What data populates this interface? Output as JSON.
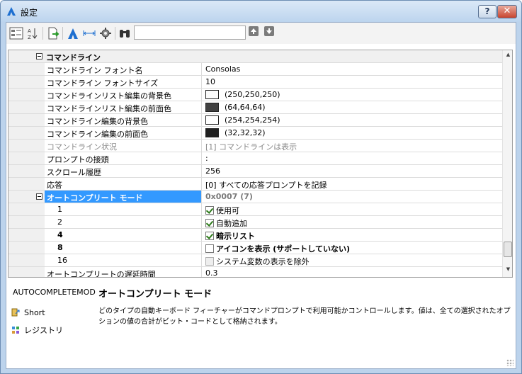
{
  "window": {
    "title": "設定",
    "help_label": "?",
    "close_label": "✕"
  },
  "toolbar": {
    "search_value": "",
    "search_placeholder": ""
  },
  "grid": {
    "category": {
      "label": "コマンドライン"
    },
    "rows": [
      {
        "name": "コマンドライン フォント名",
        "value": "Consolas"
      },
      {
        "name": "コマンドライン フォントサイズ",
        "value": "10"
      },
      {
        "name": "コマンドラインリスト編集の背景色",
        "value": "(250,250,250)",
        "swatch": "#fafafa"
      },
      {
        "name": "コマンドラインリスト編集の前面色",
        "value": "(64,64,64)",
        "swatch": "#404040"
      },
      {
        "name": "コマンドライン編集の背景色",
        "value": "(254,254,254)",
        "swatch": "#fefefe"
      },
      {
        "name": "コマンドライン編集の前面色",
        "value": "(32,32,32)",
        "swatch": "#202020"
      },
      {
        "name": "コマンドライン状況",
        "value": "[1] コマンドラインは表示"
      },
      {
        "name": "プロンプトの接頭",
        "value": ":"
      },
      {
        "name": "スクロール履歴",
        "value": "256"
      },
      {
        "name": "応答",
        "value": "[0] すべての応答プロンプトを記録"
      }
    ],
    "autocomplete": {
      "name": "オートコンプリート モード",
      "value": "0x0007 (7)"
    },
    "flags": [
      {
        "bit": "1",
        "label": "使用可"
      },
      {
        "bit": "2",
        "label": "自動追加"
      },
      {
        "bit": "4",
        "label": "暗示リスト"
      },
      {
        "bit": "8",
        "label": "アイコンを表示 (サポートしていない)"
      },
      {
        "bit": "16",
        "label": "システム変数の表示を除外"
      }
    ],
    "delay": {
      "name": "オートコンプリートの遅延時間",
      "value": "0.3"
    }
  },
  "info": {
    "variable": "AUTOCOMPLETEMOD",
    "title": "オートコンプリート モード",
    "description": "どのタイプの自動キーボード フィーチャーがコマンドプロンプトで利用可能かコントロールします。値は、全ての選択されたオプションの値の合計がビット・コードとして格納されます。",
    "links": [
      "Short",
      "レジストリ"
    ]
  }
}
